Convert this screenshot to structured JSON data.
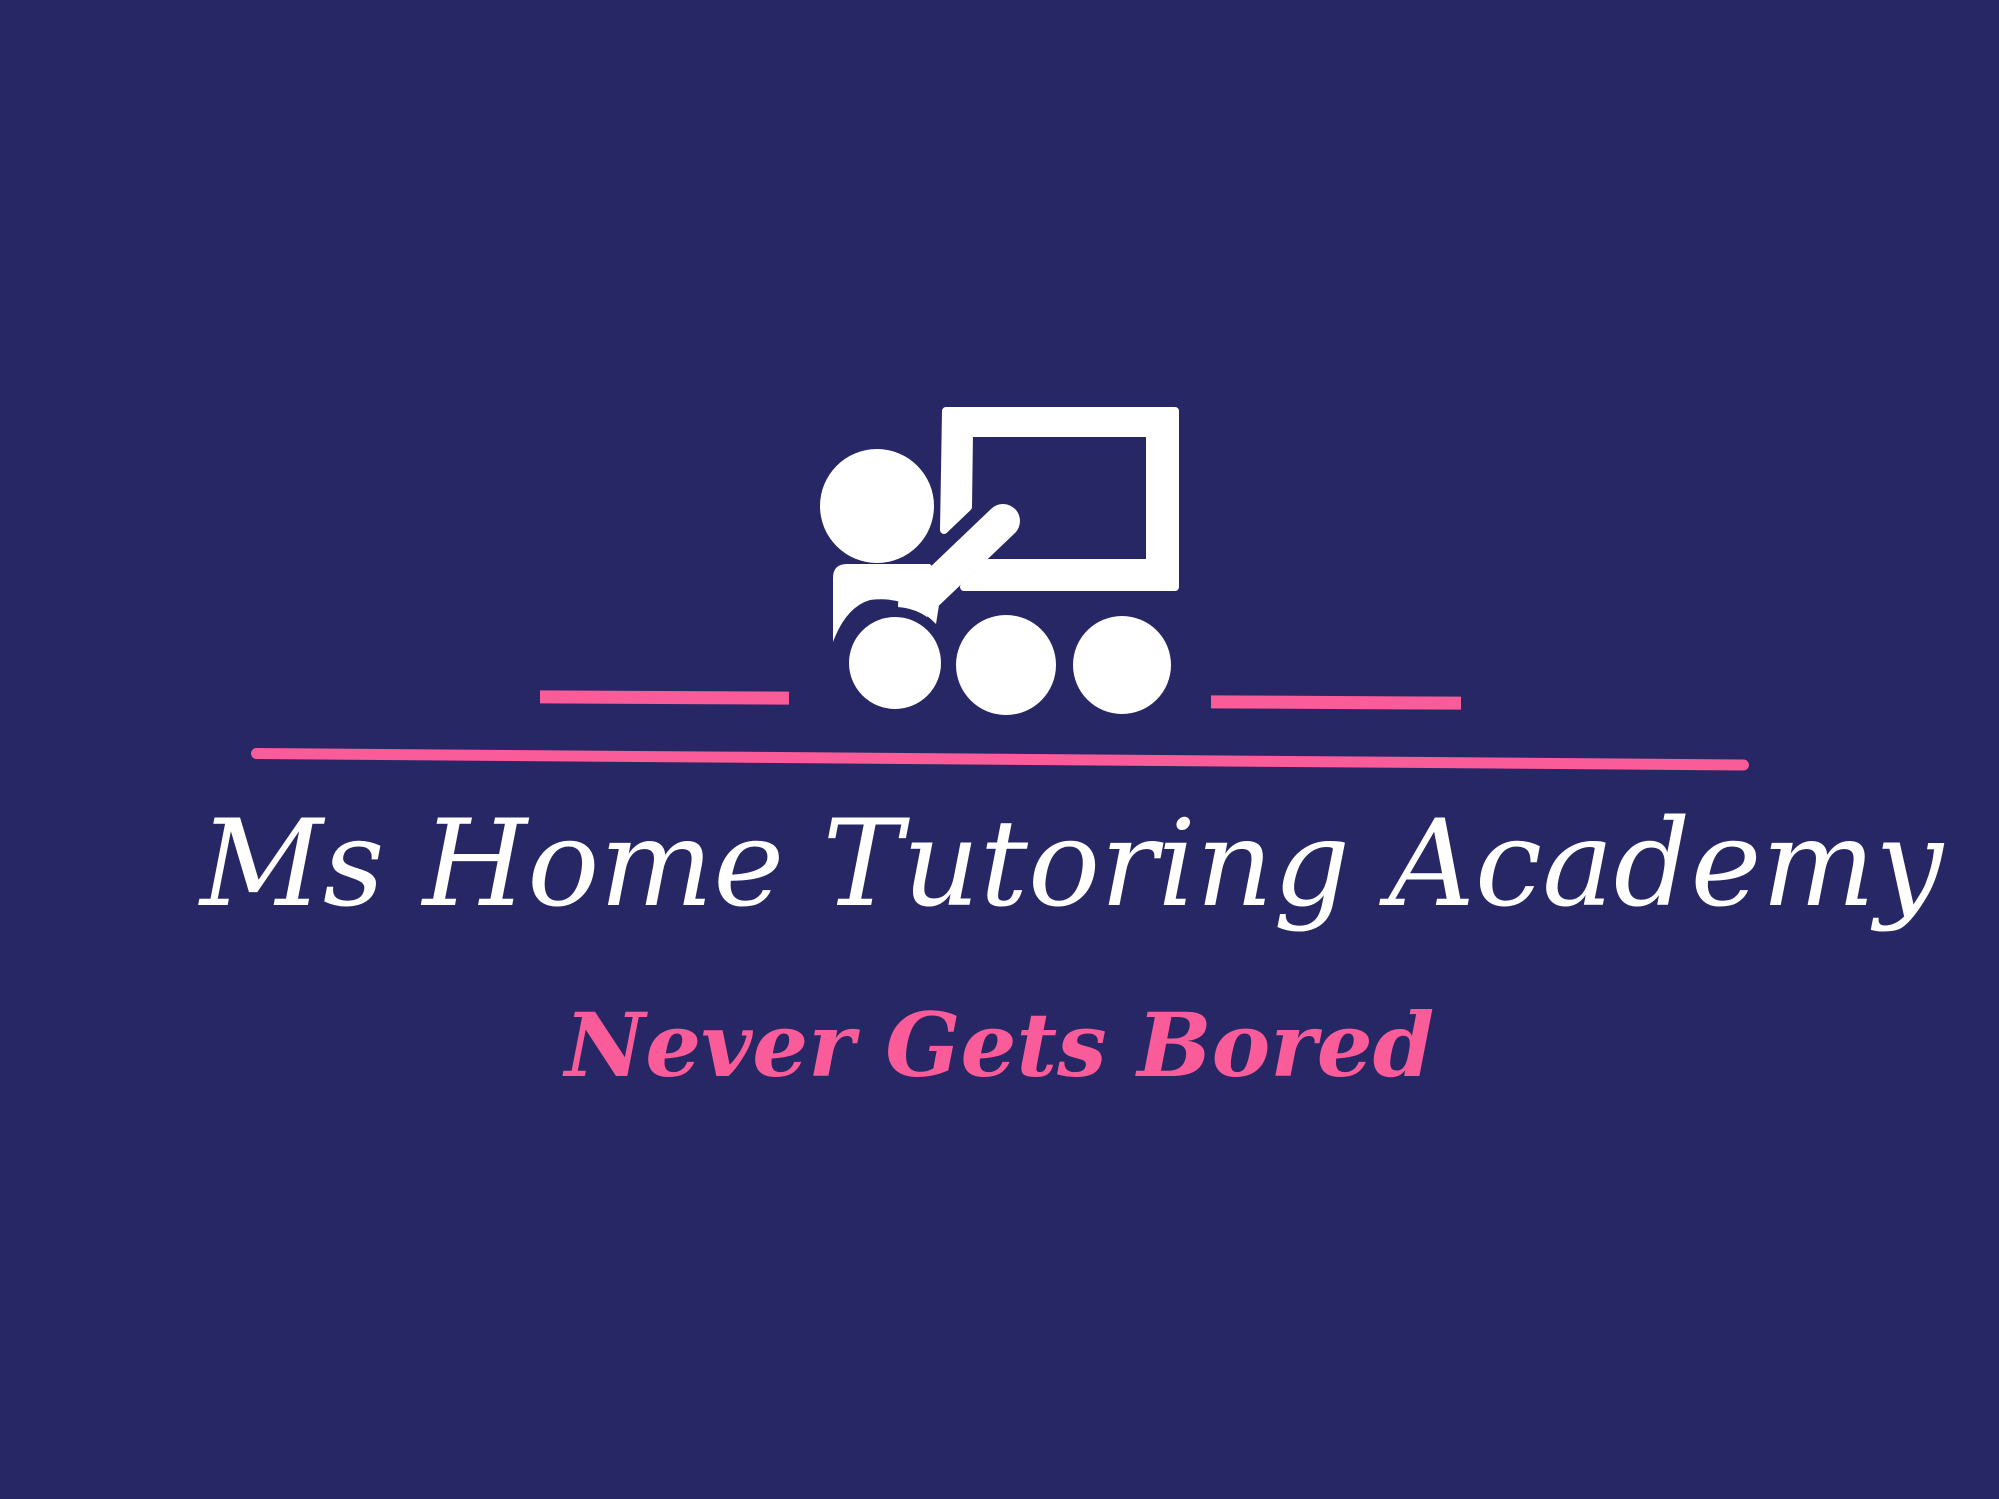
{
  "colors": {
    "background": "#272766",
    "title": "#ffffff",
    "accent": "#fa5c99"
  },
  "logo": {
    "icon": "tutor-teaching-students-icon",
    "title": "Ms Home Tutoring Academy",
    "tagline": "Never Gets Bored"
  }
}
